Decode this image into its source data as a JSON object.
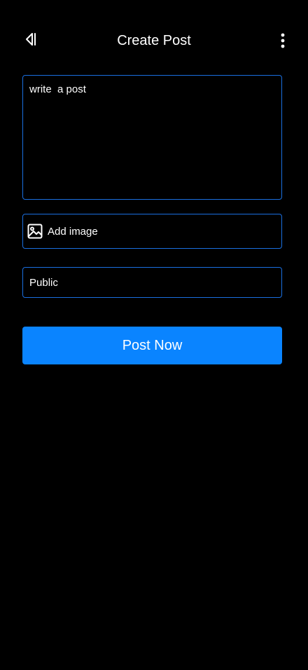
{
  "header": {
    "title": "Create Post",
    "back_icon": "collapse-left-icon",
    "menu_icon": "more-vertical-icon"
  },
  "composer": {
    "placeholder": "write  a post",
    "value": ""
  },
  "add_image": {
    "label": "Add image",
    "icon": "image-icon"
  },
  "visibility": {
    "value": "Public"
  },
  "actions": {
    "post_label": "Post Now"
  },
  "colors": {
    "background": "#000000",
    "accent": "#0a84ff",
    "field_border": "#1a6fe0",
    "text": "#ffffff"
  }
}
